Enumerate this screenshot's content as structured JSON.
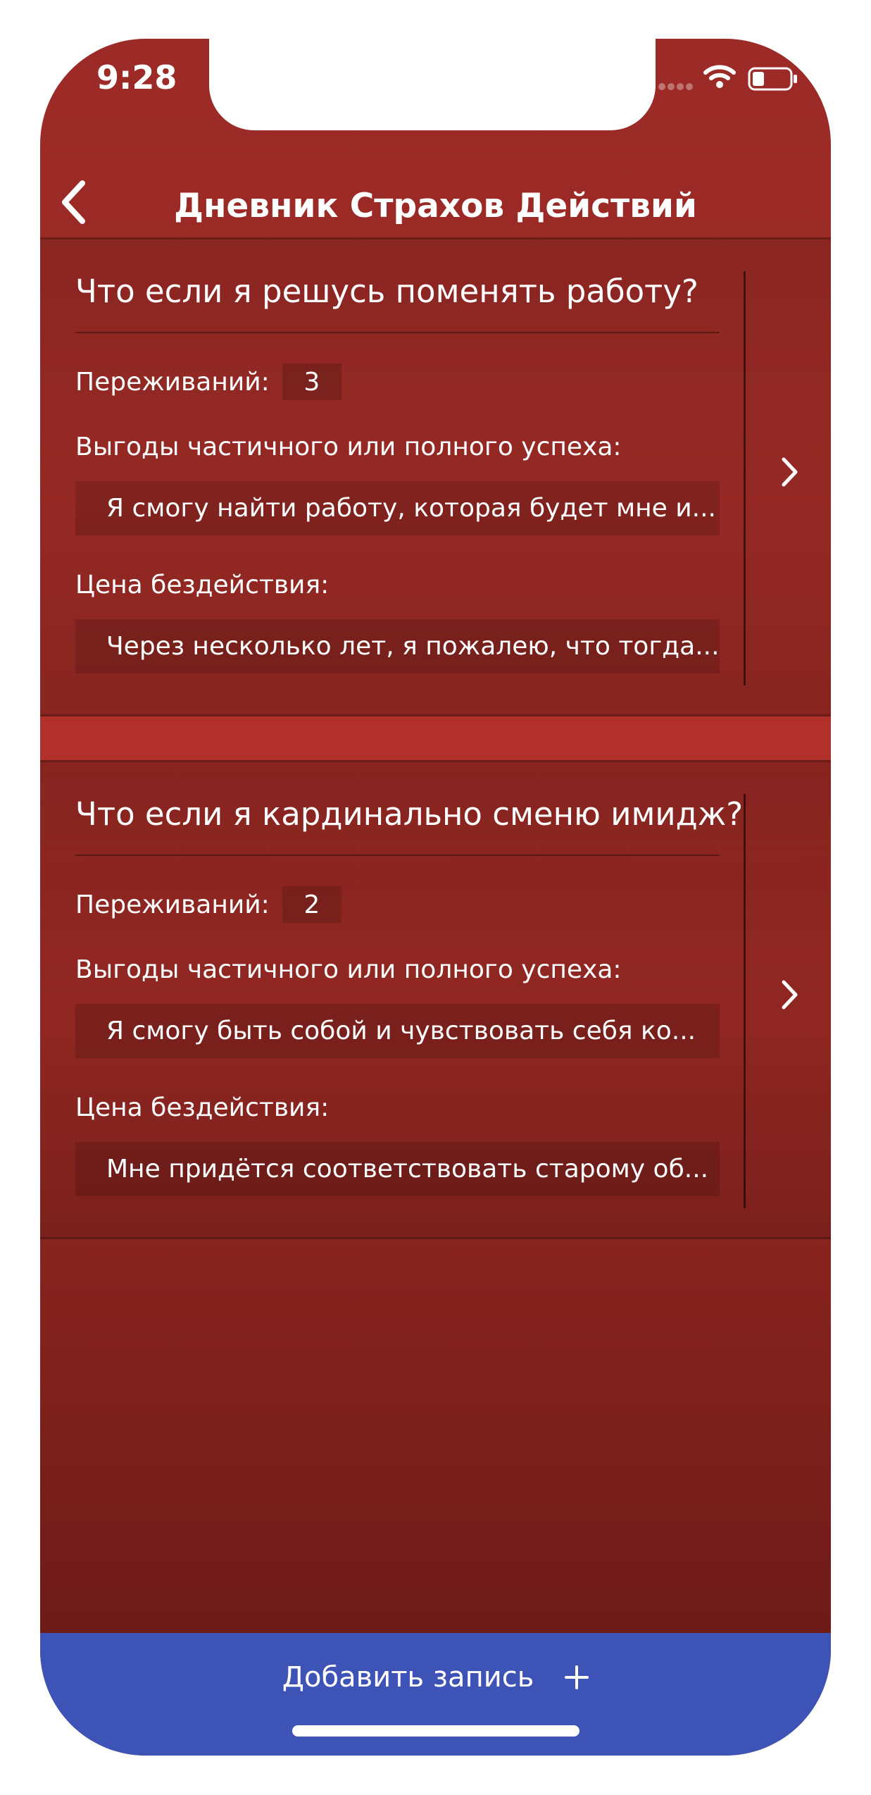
{
  "status_bar": {
    "time": "9:28",
    "icons": [
      "signal-dots-icon",
      "wifi-icon",
      "battery-icon"
    ]
  },
  "nav": {
    "back_icon": "chevron-left-icon",
    "title": "Дневник Страхов Действий"
  },
  "entries": [
    {
      "title": "Что если я решусь поменять работу?",
      "worries_label": "Переживаний:",
      "worries_count": "3",
      "benefit_label": "Выгоды частичного или полного успеха:",
      "benefit_text": "Я смогу найти работу, которая будет мне и...",
      "cost_label": "Цена бездействия:",
      "cost_text": "Через несколько лет, я пожалею, что тогда...",
      "chevron_icon": "chevron-right-icon"
    },
    {
      "title": "Что если я кардинально сменю имидж?",
      "worries_label": "Переживаний:",
      "worries_count": "2",
      "benefit_label": "Выгоды частичного или полного успеха:",
      "benefit_text": "Я смогу быть собой и чувствовать себя ко...",
      "cost_label": "Цена бездействия:",
      "cost_text": "Мне придётся соответствовать старому об...",
      "chevron_icon": "chevron-right-icon"
    }
  ],
  "add_button": {
    "label": "Добавить запись",
    "icon": "plus-icon"
  },
  "colors": {
    "header_red": "#9c2b27",
    "separator_red": "#b2302b",
    "add_bar_blue": "#3e53b6",
    "text": "#ffffff"
  }
}
